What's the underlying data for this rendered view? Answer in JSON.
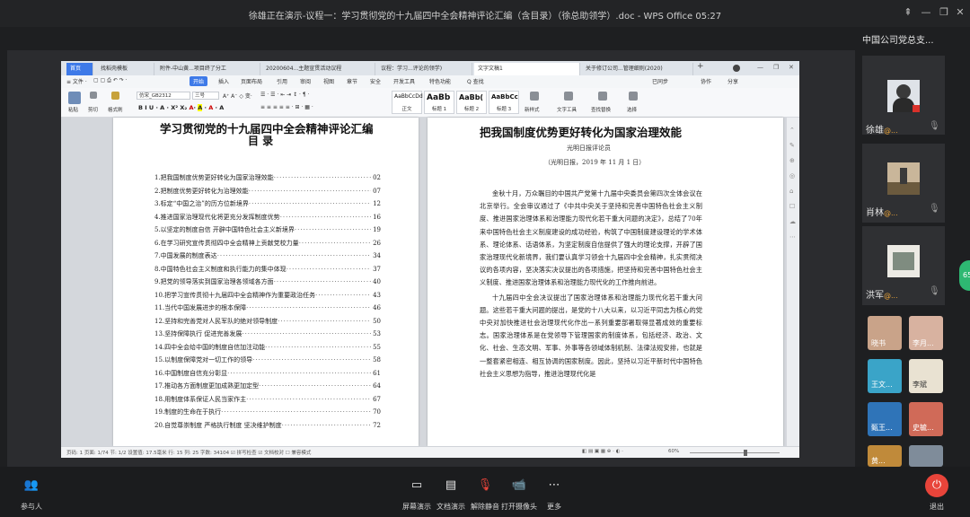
{
  "window": {
    "title": "徐雄正在演示-议程一：学习贯彻党的十九届四中全会精神评论汇编（含目录）（徐总助领学）.doc - WPS Office 05:27",
    "controls": [
      "⇞",
      "—",
      "❐",
      "✕"
    ]
  },
  "wps": {
    "tabs": [
      {
        "label": "首页",
        "kind": "home"
      },
      {
        "label": "找稻壳模板",
        "kind": "normal"
      },
      {
        "label": "附件-中山黄...项目终了分工",
        "kind": "normal"
      },
      {
        "label": "20200604...主题宣贯活动议程",
        "kind": "normal"
      },
      {
        "label": "议程：学习...评论的领学)",
        "kind": "normal"
      },
      {
        "label": "文字文稿1",
        "kind": "active"
      },
      {
        "label": "关于修订公司...管理细则(2020)",
        "kind": "normal"
      }
    ],
    "add_tab": "+",
    "menu": [
      {
        "label": "≡ 文件 ·",
        "kind": "normal"
      },
      {
        "label": "开始",
        "kind": "start"
      },
      {
        "label": "插入",
        "kind": "normal"
      },
      {
        "label": "页面布局",
        "kind": "normal"
      },
      {
        "label": "引用",
        "kind": "normal"
      },
      {
        "label": "审阅",
        "kind": "normal"
      },
      {
        "label": "视图",
        "kind": "normal"
      },
      {
        "label": "章节",
        "kind": "normal"
      },
      {
        "label": "安全",
        "kind": "normal"
      },
      {
        "label": "开发工具",
        "kind": "normal"
      },
      {
        "label": "特色功能",
        "kind": "normal"
      },
      {
        "label": "Q 查找",
        "kind": "normal"
      }
    ],
    "menu_right": [
      "已同步",
      "协作",
      "分享"
    ],
    "ribbon": {
      "paste": "粘贴",
      "cut": "剪切",
      "format_painter": "格式刷",
      "font": "仿宋_GB2312",
      "size": "三号",
      "styles": [
        {
          "sample": "AaBbCcDd",
          "name": "正文"
        },
        {
          "sample": "AaBb",
          "name": "标题 1"
        },
        {
          "sample": "AaBb(",
          "name": "标题 2"
        },
        {
          "sample": "AaBbCc",
          "name": "标题 3"
        }
      ],
      "new_style": "新样式",
      "text_tools": "文字工具",
      "find_replace": "查找替换",
      "select": "选择"
    },
    "statusbar": {
      "left": "页码: 1  页面: 1/74  节: 1/2  设置值: 17.5毫米  行: 15  列: 25  字数: 34104  ☑ 拼写检查  ☑ 文档校对  ☐ 兼容模式",
      "zoom": "60%"
    }
  },
  "doc_left": {
    "title": "学习贯彻党的十九届四中全会精神评论汇编",
    "subtitle": "目    录",
    "toc": [
      {
        "text": "1.把我国制度优势更好转化为国家治理效能",
        "page": "02"
      },
      {
        "text": "2.把制度优势更好转化为治理效能",
        "page": "07"
      },
      {
        "text": "3.标定“中国之治”的历方位新境界",
        "page": "12"
      },
      {
        "text": "4.推进国家治理现代化将更充分发挥制度优势",
        "page": "16"
      },
      {
        "text": "5.以坚定的制度自信  开辟中国特色社会主义新境界",
        "page": "19"
      },
      {
        "text": "6.在学习研究宣传贯彻四中全会精神上贡献党校力量",
        "page": "26"
      },
      {
        "text": "7.中国发展的制度表达",
        "page": "34"
      },
      {
        "text": "8.中国特色社会主义制度和执行能力的集中体现",
        "page": "37"
      },
      {
        "text": "9.把党的领导落实到国家治理各领域各方面",
        "page": "40"
      },
      {
        "text": "10.把学习宣传贯彻十九届四中全会精神作为重要政治任务",
        "page": "43"
      },
      {
        "text": "11.当代中国发展进步的根本保障",
        "page": "46"
      },
      {
        "text": "12.坚持和完善党对人民军队的绝对领导制度",
        "page": "50"
      },
      {
        "text": "13.坚持保障执行  促进完善发展",
        "page": "53"
      },
      {
        "text": "14.四中全会给中国的制度自信加注动能",
        "page": "55"
      },
      {
        "text": "15.以制度保障党对一切工作的领导",
        "page": "58"
      },
      {
        "text": "16.中国制度自信充分彰显",
        "page": "61"
      },
      {
        "text": "17.推动各方面制度更加成熟更加定型",
        "page": "64"
      },
      {
        "text": "18.用制度体系保证人民当家作主",
        "page": "67"
      },
      {
        "text": "19.制度的生命在于执行",
        "page": "70"
      },
      {
        "text": "20.自觉尊崇制度  严格执行制度  坚决维护制度",
        "page": "72"
      }
    ]
  },
  "doc_right": {
    "title": "把我国制度优势更好转化为国家治理效能",
    "byline": "光明日报评论员",
    "source": "（光明日报，2019 年 11 月 1 日）",
    "paragraphs": [
      "金秋十月，万众瞩目的中国共产党第十九届中央委员会第四次全体会议在北京举行。全会审议通过了《中共中央关于坚持和完善中国特色社会主义制度、推进国家治理体系和治理能力现代化若干重大问题的决定》，总结了70年来中国特色社会主义制度建设的成功经验，构筑了中国制度建设理论的学术体系、理论体系、话语体系，为坚定制度自信提供了强大的理论支撑，开辟了国家治理现代化新境界，我们要认真学习领会十九届四中全会精神，扎实贯彻决议的各项内容，坚决落实决议提出的各项措施，把坚持和完善中国特色社会主义制度、推进国家治理体系和治理能力现代化的工作推向前进。",
      "十九届四中全会决议提出了国家治理体系和治理能力现代化若干重大问题。这些若干重大问题的提出，是党的十八大以来，以习近平同志为核心的党中央对加快推进社会治理现代化作出一系列重要部署取得显著成效的重要标志。国家治理体系是在党领导下管理国家的制度体系，包括经济、政治、文化、社会、生态文明、军事、外事等各领域体制机制、法律法规安排，也就是一整套紧密相连、相互协调的国家制度。因此，坚持以习近平新时代中国特色社会主义思想为指导，推进治理现代化是"
    ]
  },
  "participants": {
    "meeting_name": "中国公司党总支...",
    "people": [
      {
        "name": "徐雄",
        "suffix": "@..."
      },
      {
        "name": "肖林",
        "suffix": "@..."
      },
      {
        "name": "洪军",
        "suffix": "@..."
      }
    ],
    "thumbs": [
      {
        "label": "晓书",
        "color": "#c9a389"
      },
      {
        "label": "李月...",
        "color": "#d8b2a0"
      },
      {
        "label": "王文...",
        "color": "#3aa4c8"
      },
      {
        "label": "李斌",
        "color": "#e9e2d2"
      },
      {
        "label": "甄王...",
        "color": "#2f74b8"
      },
      {
        "label": "史毓...",
        "color": "#d06a58"
      },
      {
        "label": "黄...",
        "color": "#c08a3a"
      },
      {
        "label": "",
        "color": "#7f8c9a"
      }
    ],
    "side_badge": "65"
  },
  "toolbar": {
    "participants": "参与人",
    "screen_share": "屏幕演示",
    "doc_share": "文档演示",
    "unmute": "解除静音",
    "camera": "打开摄像头",
    "more": "更多",
    "leave": "退出"
  },
  "colors": {
    "accent": "#3e7ae8",
    "leave": "#e8443a",
    "badge": "#2eb872"
  }
}
